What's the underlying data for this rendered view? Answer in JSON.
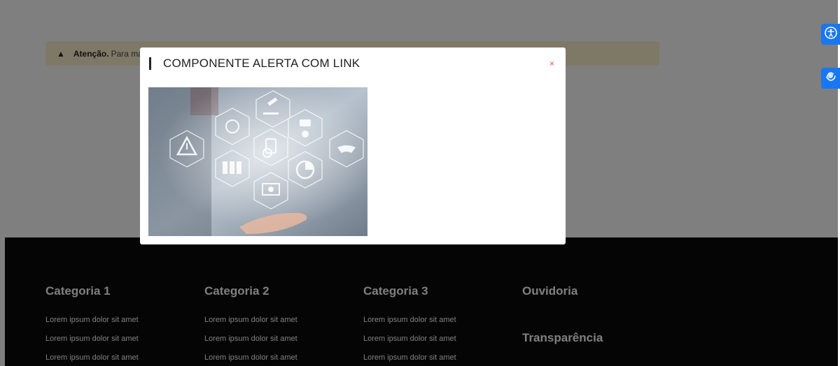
{
  "alert": {
    "strong": "Atenção.",
    "text": "Para mais"
  },
  "modal": {
    "title": "COMPONENTE ALERTA COM LINK",
    "close": "×"
  },
  "footer": {
    "columns": [
      {
        "title": "Categoria 1",
        "links": [
          "Lorem ipsum dolor sit amet",
          "Lorem ipsum dolor sit amet",
          "Lorem ipsum dolor sit amet"
        ]
      },
      {
        "title": "Categoria 2",
        "links": [
          "Lorem ipsum dolor sit amet",
          "Lorem ipsum dolor sit amet",
          "Lorem ipsum dolor sit amet"
        ]
      },
      {
        "title": "Categoria 3",
        "links": [
          "Lorem ipsum dolor sit amet",
          "Lorem ipsum dolor sit amet",
          "Lorem ipsum dolor sit amet"
        ]
      }
    ],
    "ouvidoria": "Ouvidoria",
    "transparencia": "Transparência"
  },
  "widgets": {
    "accessibility_icon": "accessibility-icon",
    "sign_language_icon": "sign-language-icon"
  }
}
